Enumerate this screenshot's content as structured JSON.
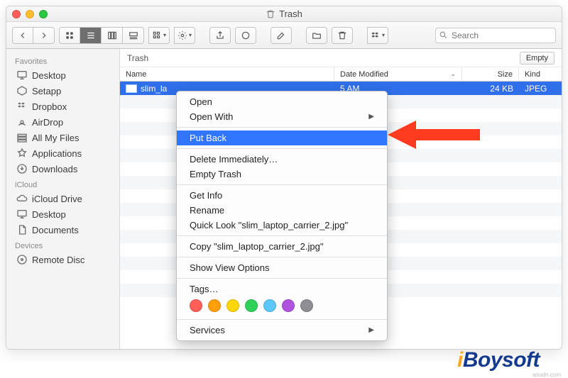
{
  "window": {
    "title": "Trash"
  },
  "toolbar": {
    "search_placeholder": "Search"
  },
  "sidebar": {
    "sections": [
      {
        "label": "Favorites",
        "items": [
          {
            "label": "Desktop",
            "icon": "desktop-icon"
          },
          {
            "label": "Setapp",
            "icon": "box-icon"
          },
          {
            "label": "Dropbox",
            "icon": "dropbox-icon"
          },
          {
            "label": "AirDrop",
            "icon": "airdrop-icon"
          },
          {
            "label": "All My Files",
            "icon": "allfiles-icon"
          },
          {
            "label": "Applications",
            "icon": "applications-icon"
          },
          {
            "label": "Downloads",
            "icon": "downloads-icon"
          }
        ]
      },
      {
        "label": "iCloud",
        "items": [
          {
            "label": "iCloud Drive",
            "icon": "cloud-icon"
          },
          {
            "label": "Desktop",
            "icon": "desktop-icon"
          },
          {
            "label": "Documents",
            "icon": "documents-icon"
          }
        ]
      },
      {
        "label": "Devices",
        "items": [
          {
            "label": "Remote Disc",
            "icon": "disc-icon"
          }
        ]
      }
    ]
  },
  "main": {
    "breadcrumb": "Trash",
    "empty_label": "Empty",
    "columns": {
      "name": "Name",
      "date": "Date Modified",
      "size": "Size",
      "kind": "Kind"
    },
    "file": {
      "name": "slim_la",
      "date": "5 AM",
      "size": "24 KB",
      "kind": "JPEG"
    }
  },
  "menu": {
    "open": "Open",
    "open_with": "Open With",
    "put_back": "Put Back",
    "delete_immediately": "Delete Immediately…",
    "empty_trash": "Empty Trash",
    "get_info": "Get Info",
    "rename": "Rename",
    "quick_look": "Quick Look \"slim_laptop_carrier_2.jpg\"",
    "copy": "Copy \"slim_laptop_carrier_2.jpg\"",
    "show_view_options": "Show View Options",
    "tags": "Tags…",
    "tag_colors": [
      "#ff5f57",
      "#ff9f0a",
      "#ffd60a",
      "#30d158",
      "#5ac8fa",
      "#af52de",
      "#8e8e93"
    ],
    "services": "Services"
  },
  "watermark": {
    "brand": "iBoysoft",
    "sub": "wsxdn.com"
  }
}
